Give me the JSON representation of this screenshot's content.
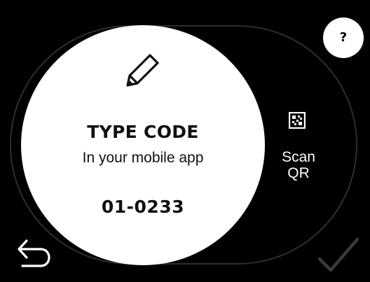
{
  "main_panel": {
    "title": "TYPE CODE",
    "subtitle": "In your mobile app",
    "code": "01-0233",
    "icon": "pencil-icon"
  },
  "scan_option": {
    "line1": "Scan",
    "line2": "QR",
    "icon": "qr-code-icon"
  },
  "help": {
    "label": "?"
  },
  "navigation": {
    "back_icon": "undo-arrow-icon",
    "confirm_icon": "checkmark-icon",
    "confirm_state": "disabled"
  },
  "colors": {
    "background": "#000000",
    "panel": "#ffffff",
    "ring": "#2e2e2e",
    "disabled_icon": "#3a3a3a"
  }
}
